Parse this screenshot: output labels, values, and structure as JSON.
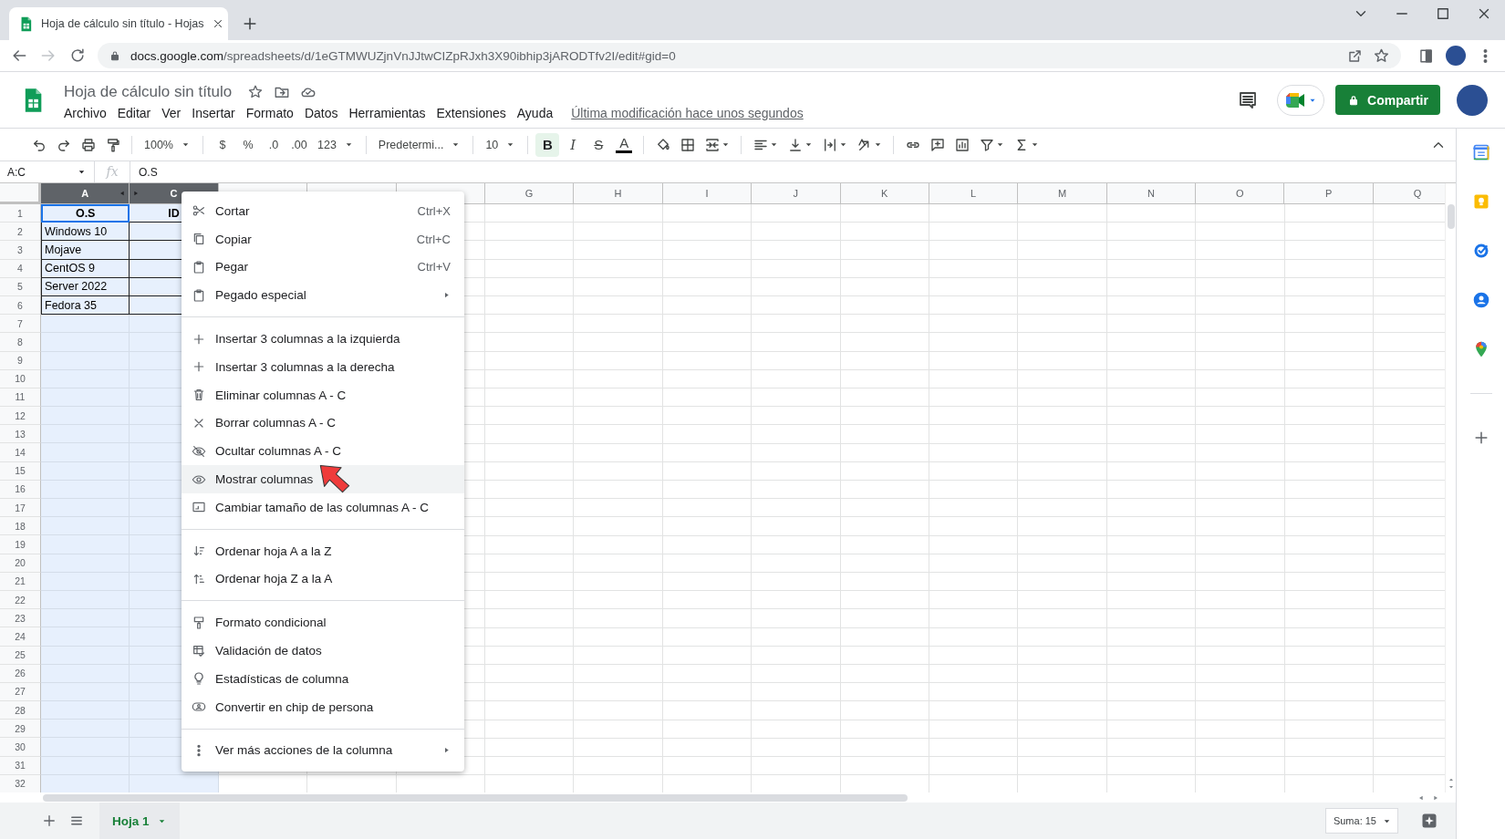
{
  "browser": {
    "tab_title": "Hoja de cálculo sin título - Hojas",
    "url": {
      "host": "docs.google.com",
      "path": "/spreadsheets/d/1eGTMWUZjnVnJJtwCIZpRJxh3X90ibhip3jARODTfv2I/edit#gid=0"
    }
  },
  "document": {
    "title": "Hoja de cálculo sin título",
    "menus": [
      "Archivo",
      "Editar",
      "Ver",
      "Insertar",
      "Formato",
      "Datos",
      "Herramientas",
      "Extensiones",
      "Ayuda"
    ],
    "last_edit": "Última modificación hace unos segundos",
    "share_button": "Compartir"
  },
  "toolbar": [
    {
      "kind": "icon",
      "caret": false
    },
    {
      "kind": "icon",
      "caret": false
    },
    {
      "kind": "icon",
      "caret": false
    },
    {
      "kind": "icon",
      "caret": false
    },
    {
      "kind": "sep"
    },
    {
      "kind": "select",
      "label": "100%"
    },
    {
      "kind": "sep"
    },
    {
      "kind": "text",
      "label": "$",
      "selected": false
    },
    {
      "kind": "text",
      "label": "%",
      "selected": false
    },
    {
      "kind": "text",
      "label": ".0",
      "selected": false
    },
    {
      "kind": "text",
      "label": ".00",
      "selected": false
    },
    {
      "kind": "select",
      "label": "123"
    },
    {
      "kind": "sep"
    },
    {
      "kind": "select",
      "label": "Predetermi..."
    },
    {
      "kind": "sep"
    },
    {
      "kind": "select",
      "label": "10"
    },
    {
      "kind": "sep"
    },
    {
      "kind": "bold",
      "label": "B",
      "selected": true
    },
    {
      "kind": "italic",
      "label": "I",
      "selected": false
    },
    {
      "kind": "strike",
      "label": "S",
      "selected": false
    },
    {
      "kind": "color",
      "label": "A",
      "selected": false
    },
    {
      "kind": "sep"
    },
    {
      "kind": "icon",
      "caret": false
    },
    {
      "kind": "icon",
      "caret": false
    },
    {
      "kind": "icon",
      "caret": true
    },
    {
      "kind": "sep"
    },
    {
      "kind": "icon",
      "caret": true
    },
    {
      "kind": "icon",
      "caret": true
    },
    {
      "kind": "icon",
      "caret": true
    },
    {
      "kind": "icon",
      "caret": true
    },
    {
      "kind": "sep"
    },
    {
      "kind": "icon",
      "caret": false
    },
    {
      "kind": "icon",
      "caret": false
    },
    {
      "kind": "icon",
      "caret": false
    },
    {
      "kind": "icon",
      "caret": true
    },
    {
      "kind": "icon",
      "caret": true
    }
  ],
  "formula_bar": {
    "name_box": "A:C",
    "fx": "fx",
    "value": "O.S"
  },
  "grid": {
    "columns": [
      {
        "label": "A",
        "selected": true,
        "hidden_next": true
      },
      {
        "label": "C",
        "selected": true,
        "hidden_next": false
      },
      {
        "selected": false,
        "hidden_next": false
      },
      {
        "selected": false,
        "hidden_next": false
      },
      {
        "selected": false,
        "hidden_next": false
      },
      {
        "label": "G",
        "selected": false,
        "hidden_next": false
      },
      {
        "label": "H",
        "selected": false,
        "hidden_next": false
      },
      {
        "label": "I",
        "selected": false,
        "hidden_next": false
      },
      {
        "label": "J",
        "selected": false,
        "hidden_next": false
      },
      {
        "label": "K",
        "selected": false,
        "hidden_next": false
      },
      {
        "label": "L",
        "selected": false,
        "hidden_next": false
      },
      {
        "label": "M",
        "selected": false,
        "hidden_next": false
      },
      {
        "label": "N",
        "selected": false,
        "hidden_next": false
      },
      {
        "label": "O",
        "selected": false,
        "hidden_next": false
      },
      {
        "label": "P",
        "selected": false,
        "hidden_next": false
      },
      {
        "label": "Q",
        "selected": false,
        "hidden_next": false
      }
    ],
    "rows": [
      {
        "number": "1",
        "bold": true,
        "cells": [
          {
            "text": "O.S",
            "active": true
          },
          {
            "text": "ID",
            "active": false
          }
        ]
      },
      {
        "number": "2",
        "bold": false,
        "cells": [
          {
            "text": "Windows 10",
            "active": false
          },
          {
            "active": false
          }
        ]
      },
      {
        "number": "3",
        "bold": false,
        "cells": [
          {
            "text": "Mojave",
            "active": false
          },
          {
            "active": false
          }
        ]
      },
      {
        "number": "4",
        "bold": false,
        "cells": [
          {
            "text": "CentOS 9",
            "active": false
          },
          {
            "active": false
          }
        ]
      },
      {
        "number": "5",
        "bold": false,
        "cells": [
          {
            "text": "Server 2022",
            "active": false
          },
          {
            "active": false
          }
        ]
      },
      {
        "number": "6",
        "bold": false,
        "cells": [
          {
            "text": "Fedora 35",
            "active": false
          },
          {
            "active": false
          }
        ]
      },
      {
        "number": "7"
      },
      {
        "number": "8"
      },
      {
        "number": "9"
      },
      {
        "number": "10"
      },
      {
        "number": "11"
      },
      {
        "number": "12"
      },
      {
        "number": "13"
      },
      {
        "number": "14"
      },
      {
        "number": "15"
      },
      {
        "number": "16"
      },
      {
        "number": "17"
      },
      {
        "number": "18"
      },
      {
        "number": "19"
      },
      {
        "number": "20"
      },
      {
        "number": "21"
      },
      {
        "number": "22"
      },
      {
        "number": "23"
      },
      {
        "number": "24"
      },
      {
        "number": "25"
      },
      {
        "number": "26"
      },
      {
        "number": "27"
      },
      {
        "number": "28"
      },
      {
        "number": "29"
      },
      {
        "number": "30"
      },
      {
        "number": "31"
      },
      {
        "number": "32"
      }
    ]
  },
  "context_menu": {
    "items": [
      {
        "kind": "item",
        "label": "Cortar",
        "shortcut": "Ctrl+X",
        "submenu": false,
        "selected": false
      },
      {
        "kind": "item",
        "label": "Copiar",
        "shortcut": "Ctrl+C",
        "submenu": false,
        "selected": false
      },
      {
        "kind": "item",
        "label": "Pegar",
        "shortcut": "Ctrl+V",
        "submenu": false,
        "selected": false
      },
      {
        "kind": "item",
        "label": "Pegado especial",
        "submenu": true,
        "selected": false
      },
      {
        "kind": "divider"
      },
      {
        "kind": "item",
        "label": "Insertar 3 columnas a la izquierda",
        "submenu": false,
        "selected": false
      },
      {
        "kind": "item",
        "label": "Insertar 3 columnas a la derecha",
        "submenu": false,
        "selected": false
      },
      {
        "kind": "item",
        "label": "Eliminar columnas A - C",
        "submenu": false,
        "selected": false
      },
      {
        "kind": "item",
        "label": "Borrar columnas A - C",
        "submenu": false,
        "selected": false
      },
      {
        "kind": "item",
        "label": "Ocultar columnas A - C",
        "submenu": false,
        "selected": false
      },
      {
        "kind": "item",
        "label": "Mostrar columnas",
        "submenu": false,
        "selected": true
      },
      {
        "kind": "item",
        "label": "Cambiar tamaño de las columnas A - C",
        "submenu": false,
        "selected": false
      },
      {
        "kind": "divider"
      },
      {
        "kind": "item",
        "label": "Ordenar hoja A a la Z",
        "submenu": false,
        "selected": false
      },
      {
        "kind": "item",
        "label": "Ordenar hoja Z a la A",
        "submenu": false,
        "selected": false
      },
      {
        "kind": "divider"
      },
      {
        "kind": "item",
        "label": "Formato condicional",
        "submenu": false,
        "selected": false
      },
      {
        "kind": "item",
        "label": "Validación de datos",
        "submenu": false,
        "selected": false
      },
      {
        "kind": "item",
        "label": "Estadísticas de columna",
        "submenu": false,
        "selected": false
      },
      {
        "kind": "item",
        "label": "Convertir en chip de persona",
        "submenu": false,
        "selected": false
      },
      {
        "kind": "divider"
      },
      {
        "kind": "item",
        "label": "Ver más acciones de la columna",
        "submenu": true,
        "selected": false
      }
    ]
  },
  "sheets": [
    {
      "label": "Hoja 1",
      "selected": true
    }
  ],
  "status": {
    "sum": "Suma: 15"
  }
}
